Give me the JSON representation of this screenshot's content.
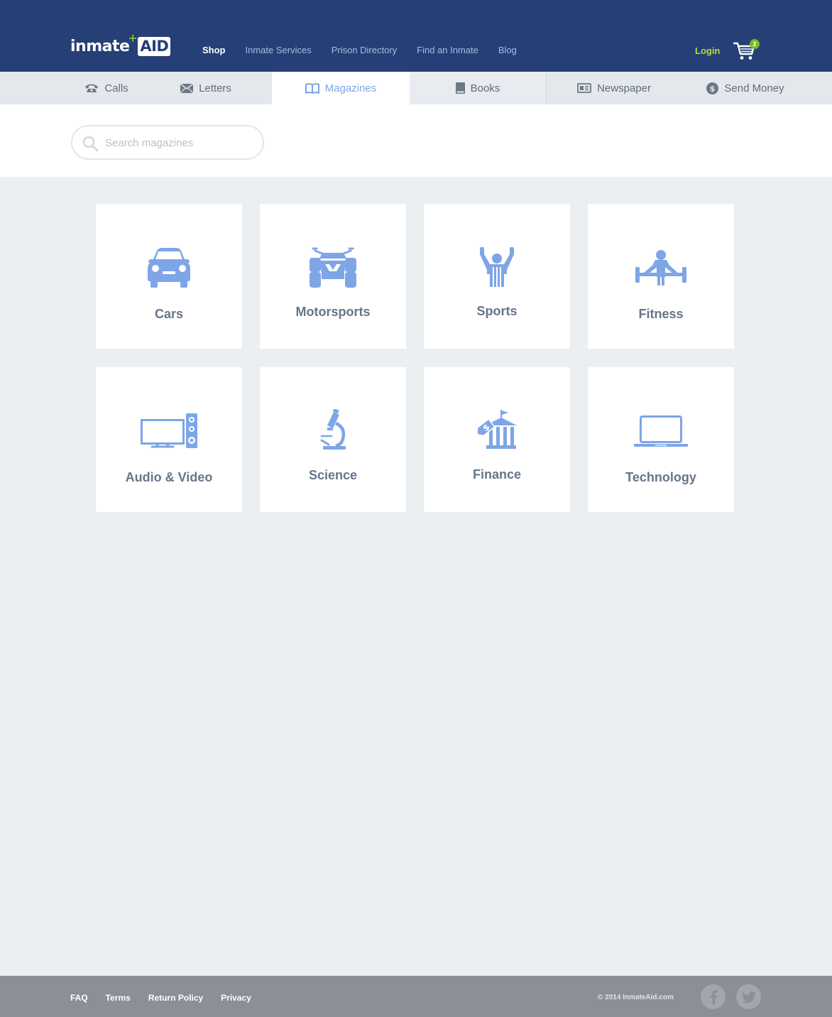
{
  "brand": {
    "name_part1": "inmate",
    "plus": "+",
    "name_part2": "AID"
  },
  "nav": {
    "items": [
      "Shop",
      "Inmate Services",
      "Prison Directory",
      "Find an Inmate",
      "Blog"
    ],
    "active": "Shop"
  },
  "login_label": "Login",
  "cart": {
    "count": "2"
  },
  "tabs": [
    {
      "label": "Calls",
      "icon": "phone-icon"
    },
    {
      "label": "Letters",
      "icon": "envelope-icon"
    },
    {
      "label": "Magazines",
      "icon": "open-book-icon",
      "active": true
    },
    {
      "label": "Books",
      "icon": "book-icon"
    },
    {
      "label": "Newspaper",
      "icon": "newspaper-icon"
    },
    {
      "label": "Send Money",
      "icon": "dollar-icon"
    }
  ],
  "search": {
    "placeholder": "Search magazines"
  },
  "categories": [
    {
      "label": "Cars",
      "icon": "car-icon"
    },
    {
      "label": "Motorsports",
      "icon": "atv-icon"
    },
    {
      "label": "Sports",
      "icon": "referee-icon"
    },
    {
      "label": "Fitness",
      "icon": "weightlifter-icon"
    },
    {
      "label": "Audio & Video",
      "icon": "tv-speaker-icon"
    },
    {
      "label": "Science",
      "icon": "microscope-icon"
    },
    {
      "label": "Finance",
      "icon": "bank-icon"
    },
    {
      "label": "Technology",
      "icon": "laptop-icon"
    }
  ],
  "footer": {
    "links": [
      "FAQ",
      "Terms",
      "Return Policy",
      "Privacy"
    ],
    "copyright": "© 2014 InmateAid.com",
    "social": [
      "facebook-icon",
      "twitter-icon"
    ]
  },
  "colors": {
    "header_bg": "#263f77",
    "accent_icon": "#7ea5e6",
    "login": "#b6db3c",
    "badge": "#79b82a",
    "page_bg": "#ebeff2",
    "footer_bg": "#8b8f96"
  }
}
